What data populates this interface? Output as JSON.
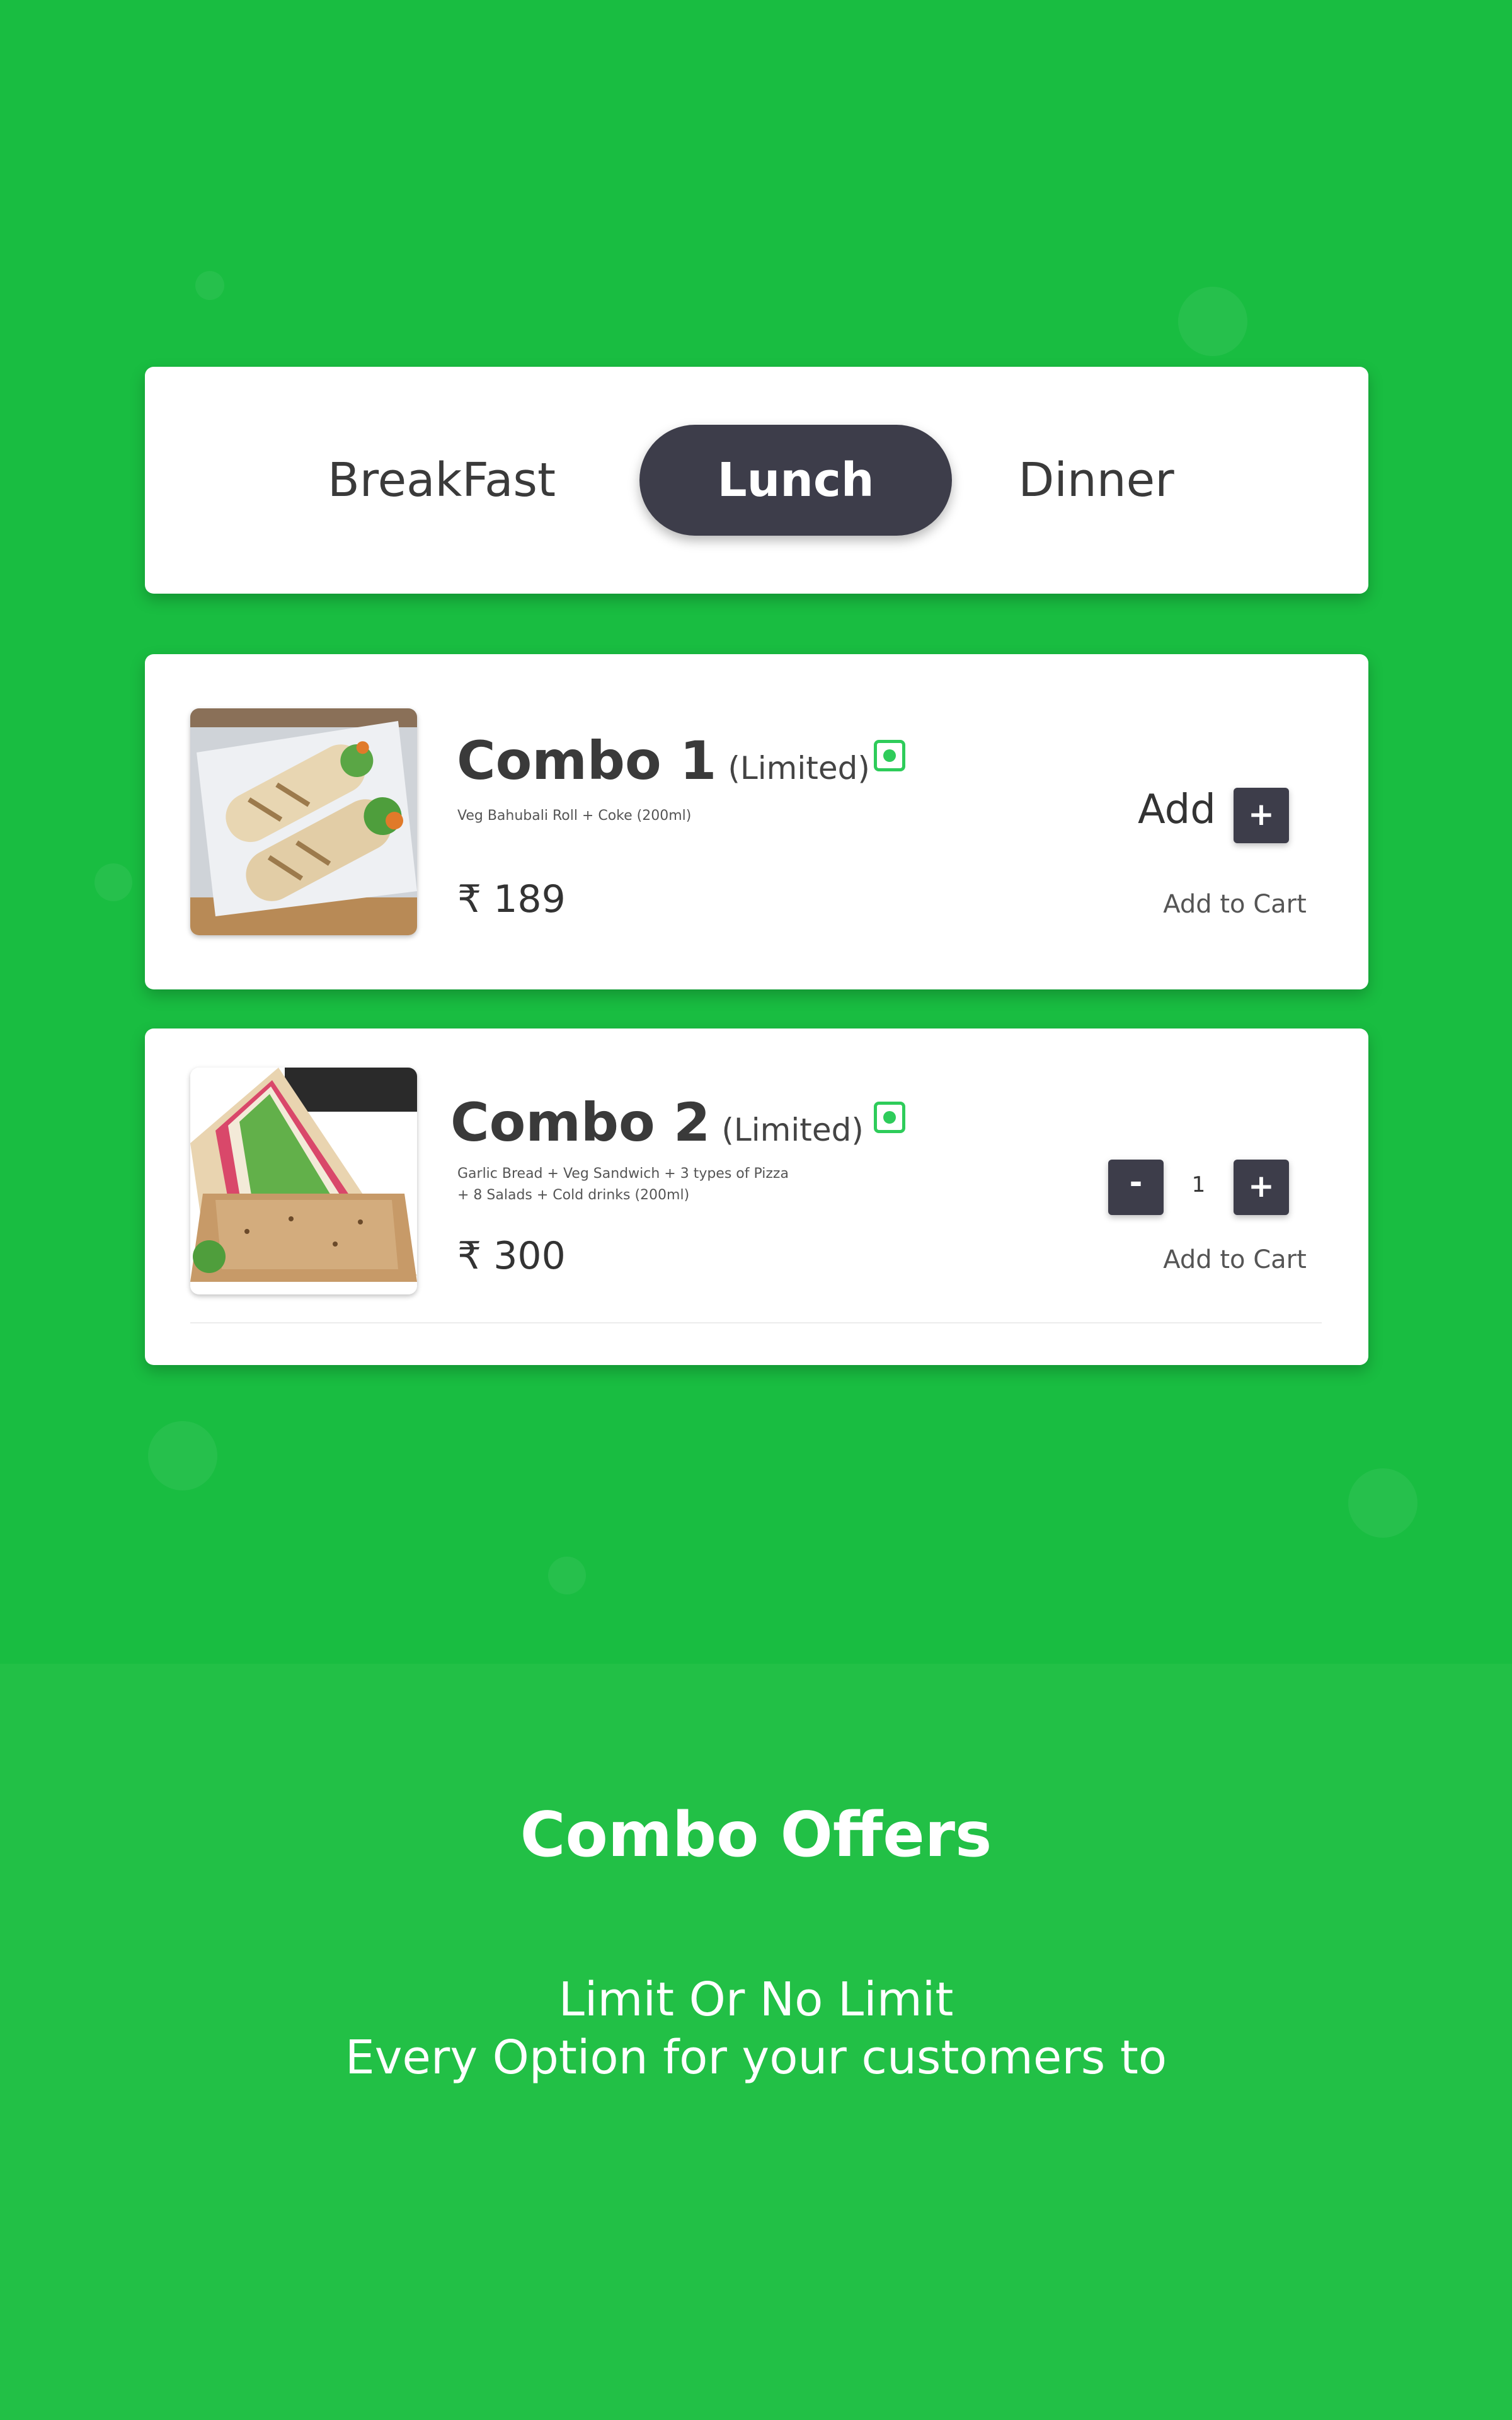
{
  "tabs": {
    "items": [
      {
        "label": "BreakFast",
        "selected": false
      },
      {
        "label": "Lunch",
        "selected": true
      },
      {
        "label": "Dinner",
        "selected": false
      }
    ]
  },
  "items": [
    {
      "name": "Combo 1",
      "tag": "(Limited)",
      "description": "Veg Bahubali Roll + Coke (200ml)",
      "price": "₹ 189",
      "add_label": "Add",
      "plus_label": "+",
      "cart_label": "Add to Cart",
      "image_icon": "wrap-roll-photo"
    },
    {
      "name": "Combo 2",
      "tag": "(Limited)",
      "description_line1": "Garlic Bread + Veg Sandwich + 3 types of Pizza",
      "description_line2": "+ 8 Salads + Cold drinks (200ml)",
      "price": "₹ 300",
      "minus_label": "-",
      "quantity": "1",
      "plus_label": "+",
      "cart_label": "Add to Cart",
      "image_icon": "sandwich-photo"
    }
  ],
  "section": {
    "title": "Combo Offers",
    "line1": "Limit Or No Limit",
    "line2": "Every Option for your customers to"
  },
  "colors": {
    "background_top": "#19bd41",
    "background_bottom": "#22c046",
    "dark_button": "#3d3d4a",
    "veg_mark": "#2ecc5a"
  }
}
